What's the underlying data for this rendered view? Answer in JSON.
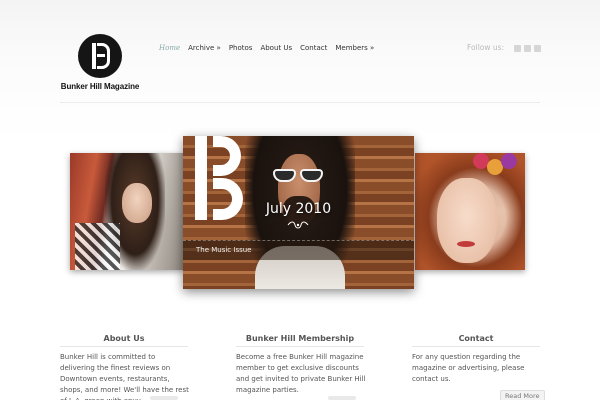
{
  "header": {
    "logo_text": "Bunker Hill Magazine",
    "nav": [
      {
        "label": "Home",
        "active": true
      },
      {
        "label": "Archive »"
      },
      {
        "label": "Photos"
      },
      {
        "label": "About Us"
      },
      {
        "label": "Contact"
      },
      {
        "label": "Members »"
      }
    ],
    "follow_label": "Follow us:",
    "social_icons": [
      "twitter-icon",
      "rss-icon",
      "facebook-icon"
    ]
  },
  "slider": {
    "featured_title": "July 2010",
    "featured_subtitle": "The Music Issue"
  },
  "footer": {
    "columns": [
      {
        "title": "About Us",
        "text": "Bunker Hill is committed to delivering the finest reviews on Downtown events, restaurants, shops, and more! We'll have the rest of L.A. green with envy..."
      },
      {
        "title": "Bunker Hill Membership",
        "text": "Become a free Bunker Hill magazine member to get exclusive discounts and get invited to private Bunker Hill magazine parties."
      },
      {
        "title": "Contact",
        "text": "For any question regarding the magazine or advertising, please contact us."
      }
    ],
    "read_more": "Read More"
  },
  "colors": {
    "active_nav": "#88aaaa",
    "logo_bg": "#151515"
  }
}
